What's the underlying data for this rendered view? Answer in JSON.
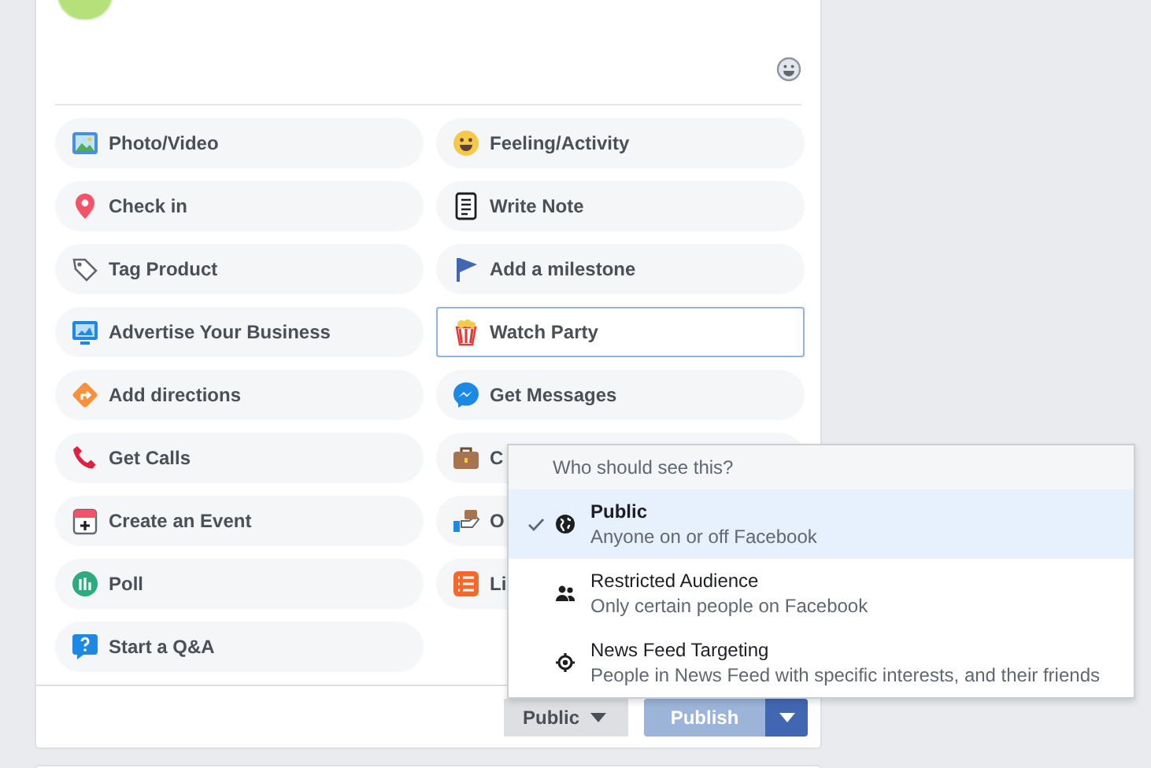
{
  "composer": {
    "actions": [
      {
        "label": "Photo/Video",
        "selected": false
      },
      {
        "label": "Feeling/Activity",
        "selected": false
      },
      {
        "label": "Check in",
        "selected": false
      },
      {
        "label": "Write Note",
        "selected": false
      },
      {
        "label": "Tag Product",
        "selected": false
      },
      {
        "label": "Add a milestone",
        "selected": false
      },
      {
        "label": "Advertise Your Business",
        "selected": false
      },
      {
        "label": "Watch Party",
        "selected": true
      },
      {
        "label": "Add directions",
        "selected": false
      },
      {
        "label": "Get Messages",
        "selected": false
      },
      {
        "label": "Get Calls",
        "selected": false
      },
      {
        "label": "C",
        "selected": false
      },
      {
        "label": "Create an Event",
        "selected": false
      },
      {
        "label": "O",
        "selected": false
      },
      {
        "label": "Poll",
        "selected": false
      },
      {
        "label": "Li",
        "selected": false
      },
      {
        "label": "Start a Q&A",
        "selected": false
      }
    ]
  },
  "audience_menu": {
    "header": "Who should see this?",
    "options": [
      {
        "title": "Public",
        "subtitle": "Anyone on or off Facebook",
        "selected": true
      },
      {
        "title": "Restricted Audience",
        "subtitle": "Only certain people on Facebook",
        "selected": false
      },
      {
        "title": "News Feed Targeting",
        "subtitle": "People in News Feed with specific interests, and their friends",
        "selected": false
      }
    ]
  },
  "footer": {
    "audience_button": "Public",
    "publish_button": {
      "label": "Publish",
      "disabled": true
    }
  }
}
